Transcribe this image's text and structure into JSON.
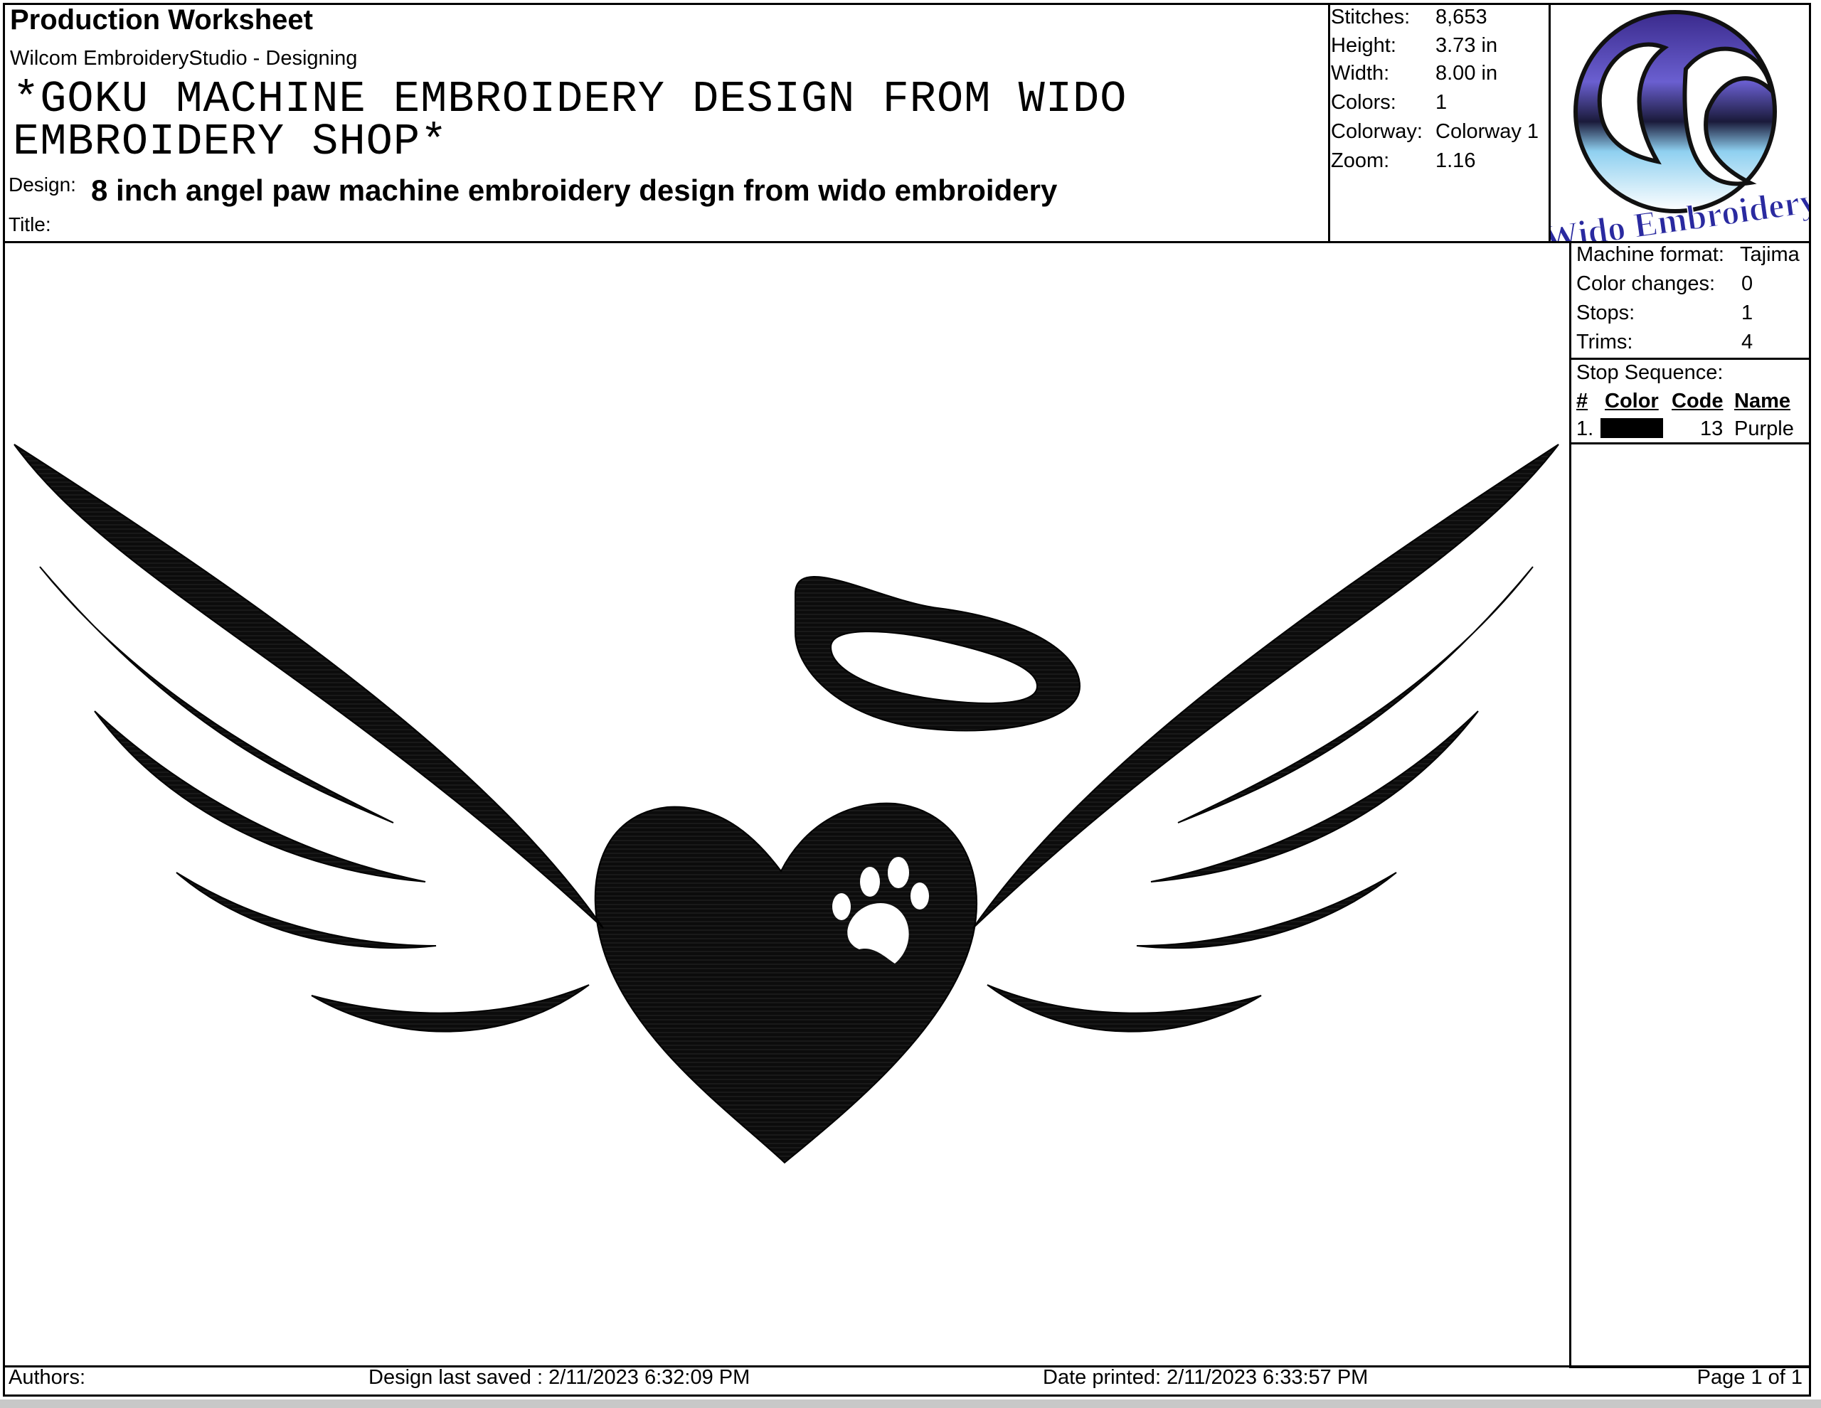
{
  "header": {
    "title": "Production Worksheet",
    "software": "Wilcom EmbroideryStudio - Designing",
    "design_title": "*GOKU MACHINE EMBROIDERY DESIGN FROM WIDO EMBROIDERY SHOP*",
    "design_label": "Design:",
    "design_name": "8 inch angel paw machine embroidery design from wido embroidery",
    "title_label": "Title:"
  },
  "stats": {
    "stitches_label": "Stitches:",
    "stitches": "8,653",
    "height_label": "Height:",
    "height": "3.73 in",
    "width_label": "Width:",
    "width": "8.00 in",
    "colors_label": "Colors:",
    "colors": "1",
    "colorway_label": "Colorway:",
    "colorway": "Colorway 1",
    "zoom_label": "Zoom:",
    "zoom": "1.16"
  },
  "logo": {
    "text": "Wido Embroidery",
    "icon": "wido-logo-icon"
  },
  "machine": {
    "format_label": "Machine format:",
    "format": "Tajima",
    "color_changes_label": "Color changes:",
    "color_changes": "0",
    "stops_label": "Stops:",
    "stops": "1",
    "trims_label": "Trims:",
    "trims": "4"
  },
  "stop_sequence": {
    "label": "Stop Sequence:",
    "headers": [
      "#",
      "Color",
      "Code",
      "Name"
    ],
    "rows": [
      {
        "num": "1.",
        "color": "#000000",
        "code": "13",
        "name": "Purple"
      }
    ]
  },
  "artwork": {
    "icon": "angel-wings-heart-paw-icon"
  },
  "footer": {
    "authors_label": "Authors:",
    "last_saved": "Design last saved : 2/11/2023 6:32:09 PM",
    "date_printed": "Date printed: 2/11/2023 6:33:57 PM",
    "page": "Page 1 of 1"
  }
}
